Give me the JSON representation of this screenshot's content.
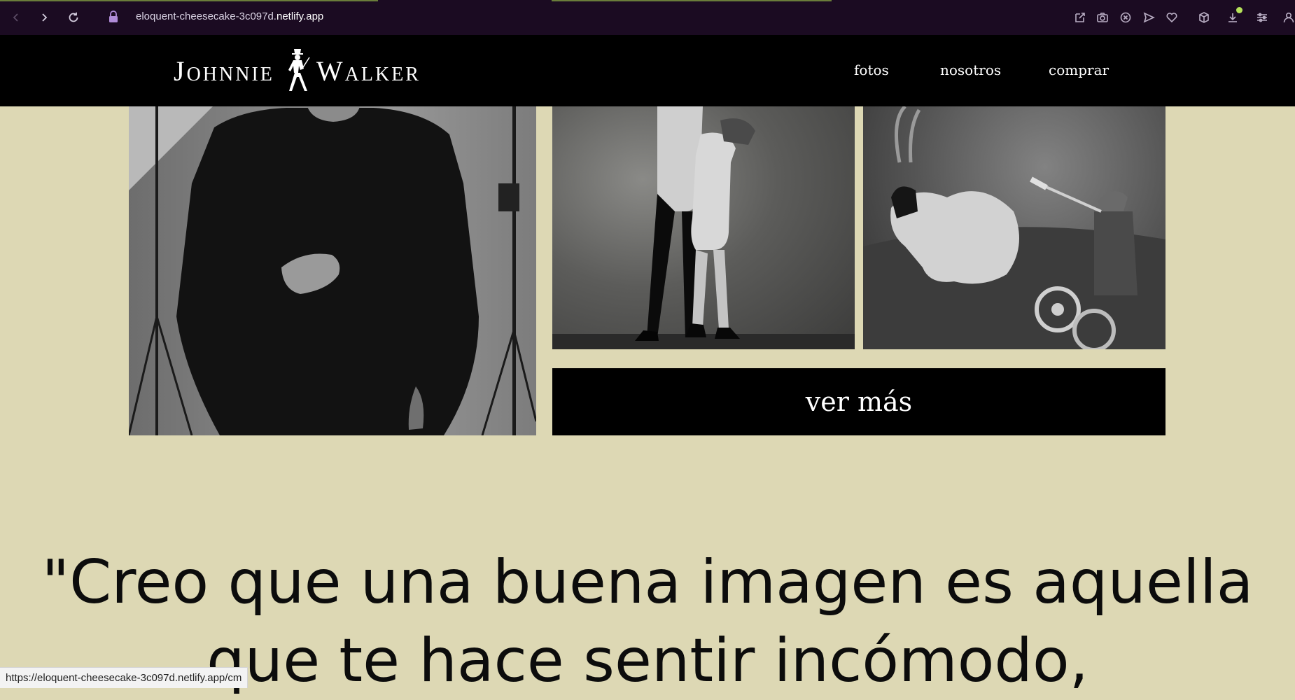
{
  "browser": {
    "url_prefix": "eloquent-cheesecake-3c097d.",
    "url_host": "netlify.app",
    "status_url": "https://eloquent-cheesecake-3c097d.netlify.app/cm",
    "colors": {
      "chrome_bg": "#1b0b22",
      "download_badge": "#b6e35a"
    },
    "toolbar_icons": [
      "share-icon",
      "camera-icon",
      "close-circle-icon",
      "send-icon",
      "heart-icon",
      "cube-icon",
      "download-icon",
      "settings-sliders-icon",
      "account-icon"
    ]
  },
  "site": {
    "logo_left": "Johnnie",
    "logo_right": "Walker",
    "nav": {
      "fotos": "fotos",
      "nosotros": "nosotros",
      "comprar": "comprar"
    },
    "colors": {
      "header_bg": "#000000",
      "page_bg": "#ddd8b4",
      "button_bg": "#000000"
    }
  },
  "gallery": {
    "button_label": "ver más"
  },
  "quote": {
    "line1": "\"Creo que una buena imagen es aquella",
    "line2": "que te hace sentir incómodo,"
  }
}
